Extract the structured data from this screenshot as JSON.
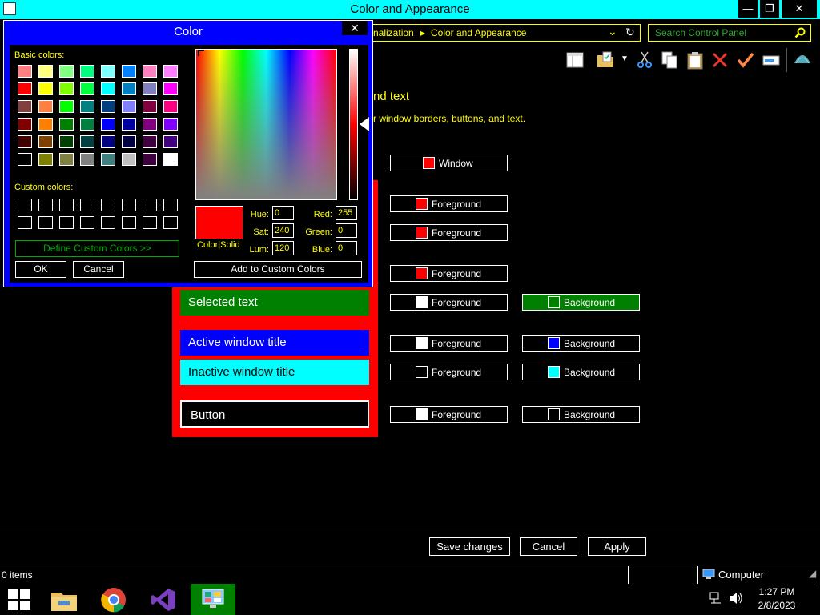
{
  "window": {
    "title": "Color and Appearance",
    "minimize": "—",
    "maximize": "❐",
    "close": "✕"
  },
  "address": {
    "crumb1": "nalization",
    "sep": "▸",
    "crumb2": "Color and Appearance",
    "dropdown": "⌄",
    "refresh": "↻"
  },
  "search": {
    "placeholder": "Search Control Panel",
    "icon": "search-icon"
  },
  "page": {
    "heading_partial": "nd text",
    "desc_partial": "r window borders, buttons, and text."
  },
  "elements": [
    {
      "label": "Window",
      "color": "#ff0000"
    },
    {
      "label": "Foreground",
      "color": "#ff0000"
    },
    {
      "label": "Foreground",
      "color": "#ff0000"
    },
    {
      "label": "Foreground",
      "color": "#ff0000"
    },
    {
      "label": "Foreground",
      "color": "#ffffff"
    },
    {
      "label": "Background",
      "color": "#008000"
    },
    {
      "label": "Foreground",
      "color": "#ffffff"
    },
    {
      "label": "Background",
      "color": "#0000ff"
    },
    {
      "label": "Foreground",
      "color": "#000000"
    },
    {
      "label": "Background",
      "color": "#00ffff"
    },
    {
      "label": "Foreground",
      "color": "#ffffff"
    },
    {
      "label": "Background",
      "color": "#000000"
    }
  ],
  "preview": {
    "selected_text": "Selected text",
    "active_title": "Active window title",
    "inactive_title": "Inactive window title",
    "button": "Button"
  },
  "commands": {
    "save": "Save changes",
    "cancel": "Cancel",
    "apply": "Apply"
  },
  "status": {
    "items": "0 items",
    "location": "Computer"
  },
  "taskbar": {
    "time": "1:27 PM",
    "date": "2/8/2023",
    "apps": [
      "start-icon",
      "file-explorer-icon",
      "chrome-icon",
      "visual-studio-icon",
      "control-panel-icon"
    ]
  },
  "color_dialog": {
    "title": "Color",
    "close": "✕",
    "basic_label": "Basic colors:",
    "custom_label": "Custom colors:",
    "define_custom": "Define Custom Colors >>",
    "ok": "OK",
    "cancel": "Cancel",
    "add_custom": "Add to Custom Colors",
    "color_solid": "Color|Solid",
    "hue_label": "Hue:",
    "hue": "0",
    "sat_label": "Sat:",
    "sat": "240",
    "lum_label": "Lum:",
    "lum": "120",
    "red_label": "Red:",
    "red": "255",
    "green_label": "Green:",
    "green": "0",
    "blue_label": "Blue:",
    "blue": "0",
    "selected_color": "#ff0000",
    "basic_colors": [
      "#ff8080",
      "#ffff80",
      "#80ff80",
      "#00ff80",
      "#80ffff",
      "#0080ff",
      "#ff80c0",
      "#ff80ff",
      "#ff0000",
      "#ffff00",
      "#80ff00",
      "#00ff40",
      "#00ffff",
      "#0080c0",
      "#8080c0",
      "#ff00ff",
      "#804040",
      "#ff8040",
      "#00ff00",
      "#008080",
      "#004080",
      "#8080ff",
      "#800040",
      "#ff0080",
      "#800000",
      "#ff8000",
      "#008000",
      "#008040",
      "#0000ff",
      "#0000a0",
      "#800080",
      "#8000ff",
      "#400000",
      "#804000",
      "#004000",
      "#004040",
      "#000080",
      "#000040",
      "#400040",
      "#400080",
      "#000000",
      "#808000",
      "#808040",
      "#808080",
      "#408080",
      "#c0c0c0",
      "#400040",
      "#ffffff"
    ]
  }
}
